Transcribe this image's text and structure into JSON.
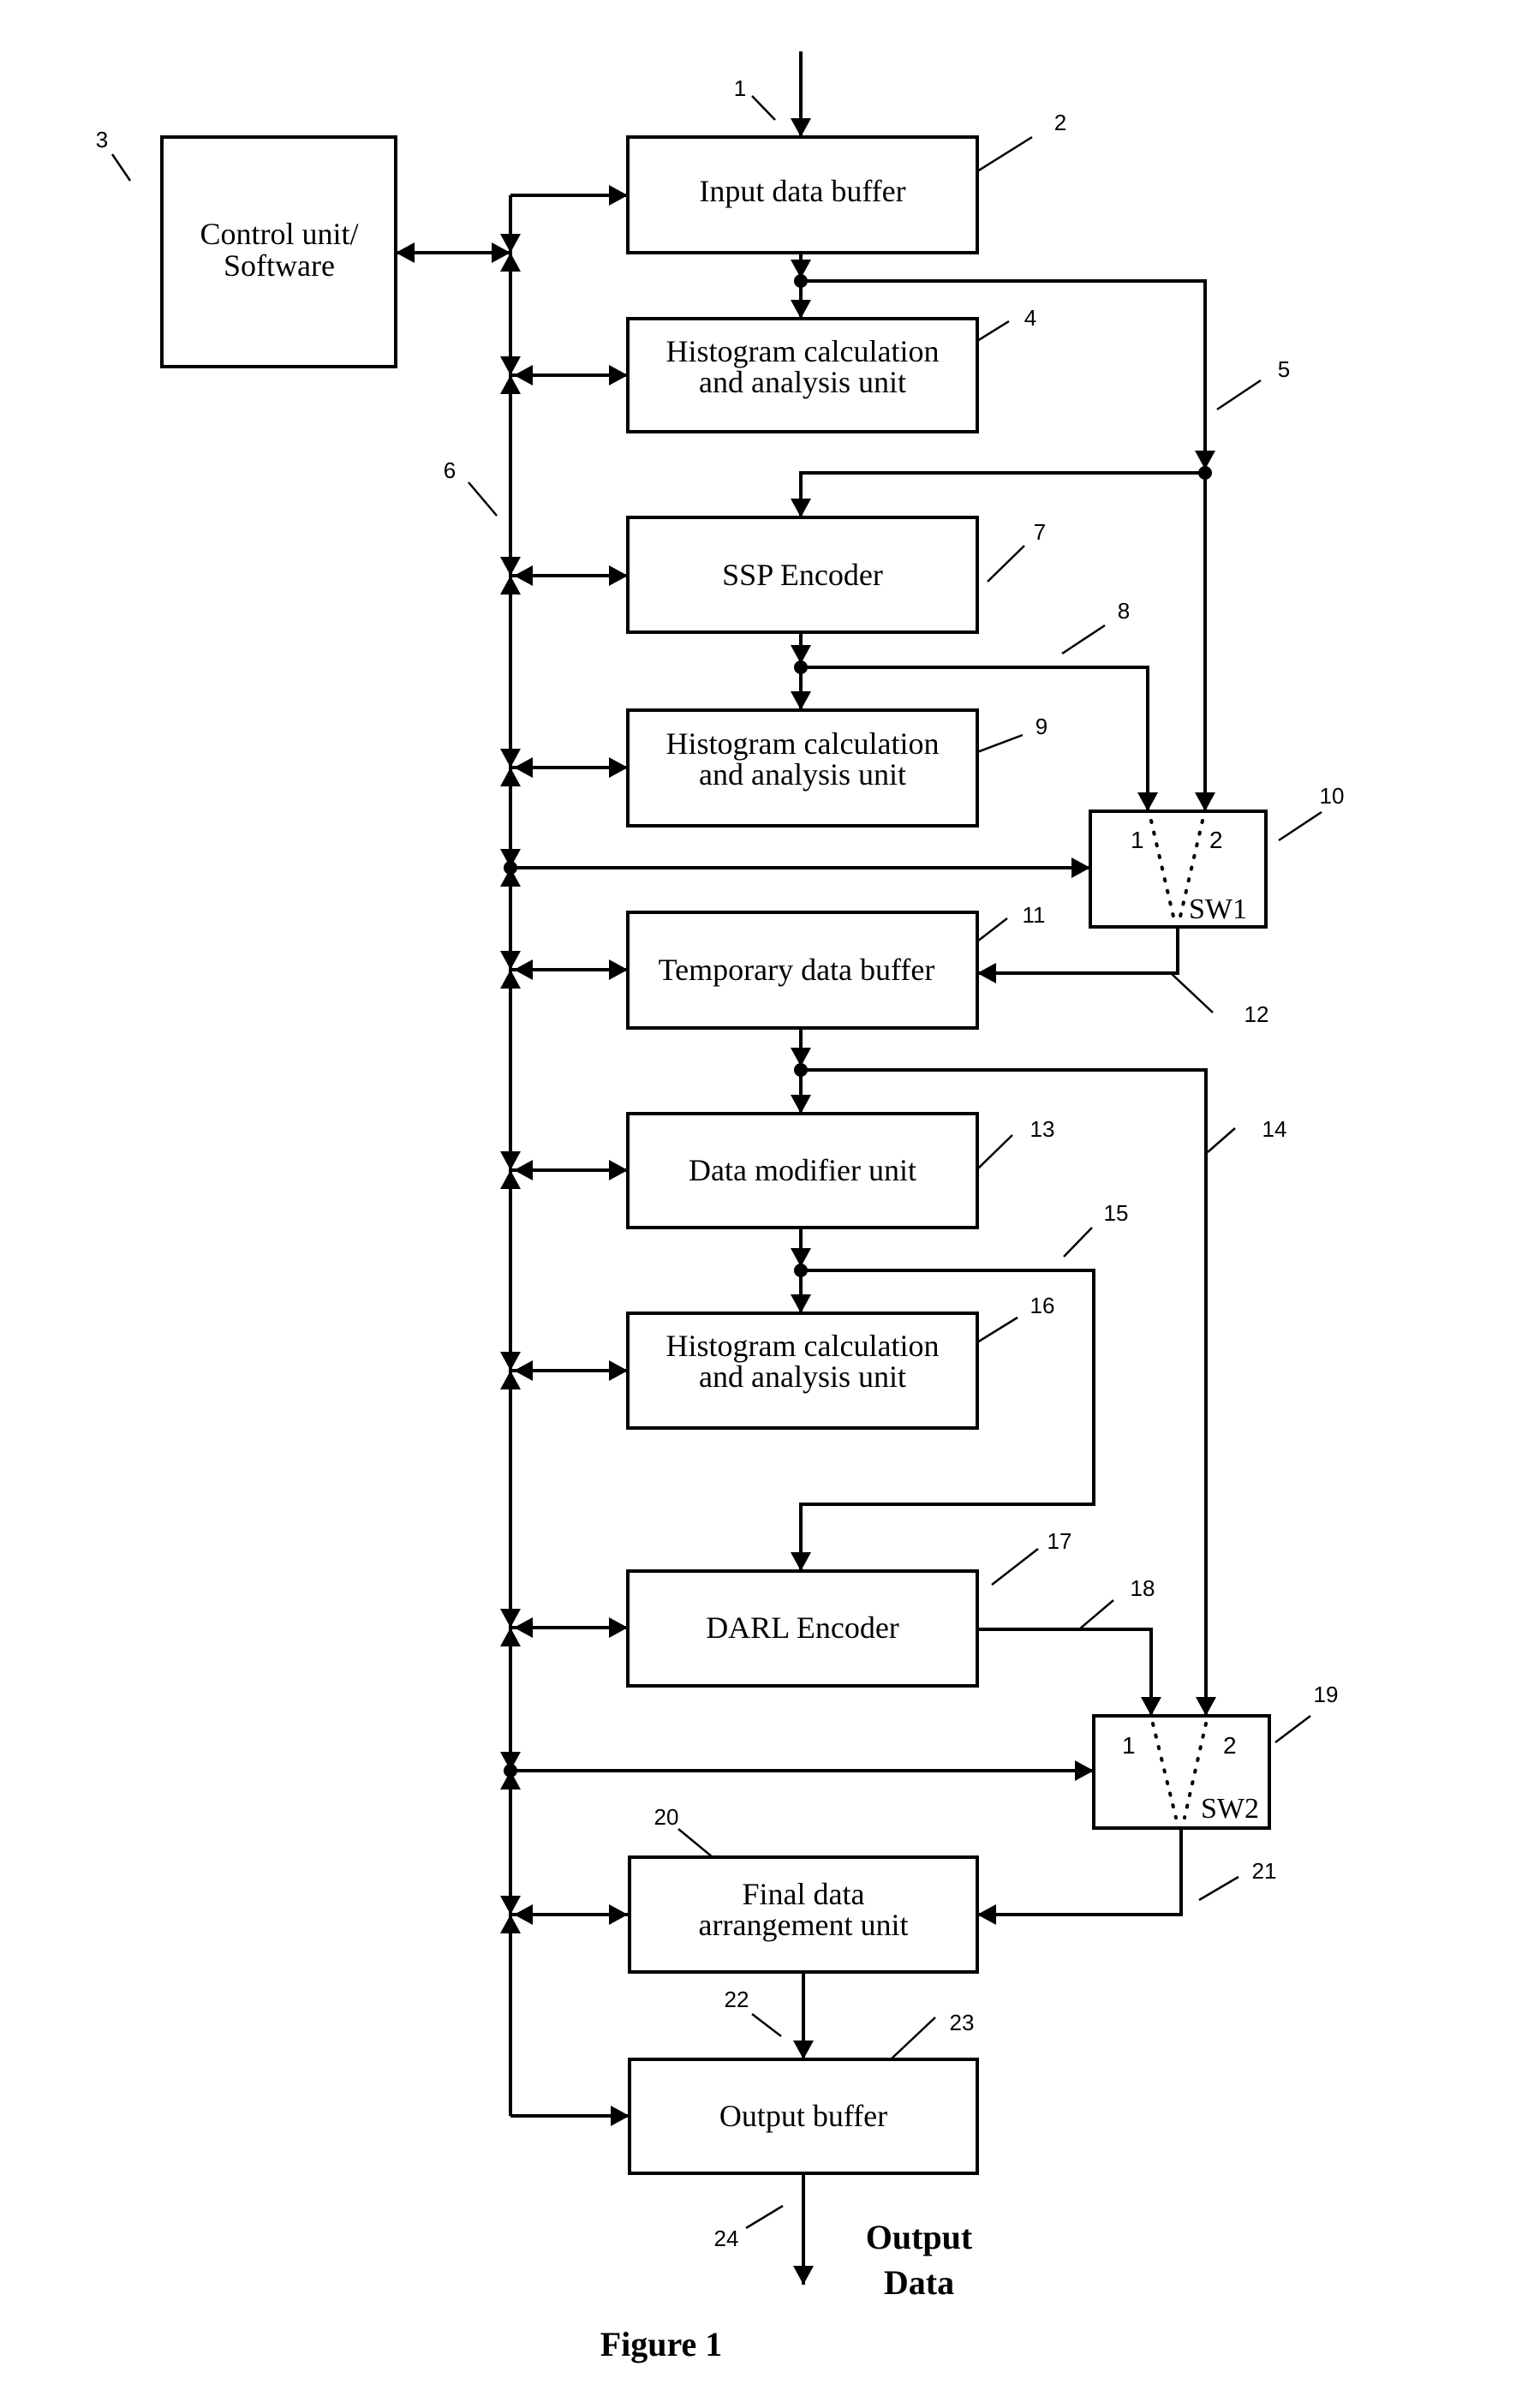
{
  "figure": {
    "caption": "Figure 1",
    "output_label": [
      "Output",
      "Data"
    ]
  },
  "blocks": {
    "control_unit": [
      "Control unit/",
      "Software"
    ],
    "input_data_buffer": [
      "Input data buffer"
    ],
    "histogram_1": [
      "Histogram calculation",
      "and analysis unit"
    ],
    "ssp_encoder": [
      "SSP Encoder"
    ],
    "histogram_2": [
      "Histogram calculation",
      "and analysis unit"
    ],
    "temporary_data_buffer": [
      "Temporary data buffer"
    ],
    "data_modifier_unit": [
      "Data modifier unit"
    ],
    "histogram_3": [
      "Histogram calculation",
      "and analysis unit"
    ],
    "darl_encoder": [
      "DARL Encoder"
    ],
    "final_data_arrangement_unit": [
      "Final data",
      "arrangement unit"
    ],
    "output_buffer": [
      "Output buffer"
    ]
  },
  "switches": {
    "sw1": {
      "name": "SW1",
      "input_1": "1",
      "input_2": "2"
    },
    "sw2": {
      "name": "SW2",
      "input_1": "1",
      "input_2": "2"
    }
  },
  "reference_numerals": {
    "r1": "1",
    "r2": "2",
    "r3": "3",
    "r4": "4",
    "r5": "5",
    "r6": "6",
    "r7": "7",
    "r8": "8",
    "r9": "9",
    "r10": "10",
    "r11": "11",
    "r12": "12",
    "r13": "13",
    "r14": "14",
    "r15": "15",
    "r16": "16",
    "r17": "17",
    "r18": "18",
    "r19": "19",
    "r20": "20",
    "r21": "21",
    "r22": "22",
    "r23": "23",
    "r24": "24"
  }
}
